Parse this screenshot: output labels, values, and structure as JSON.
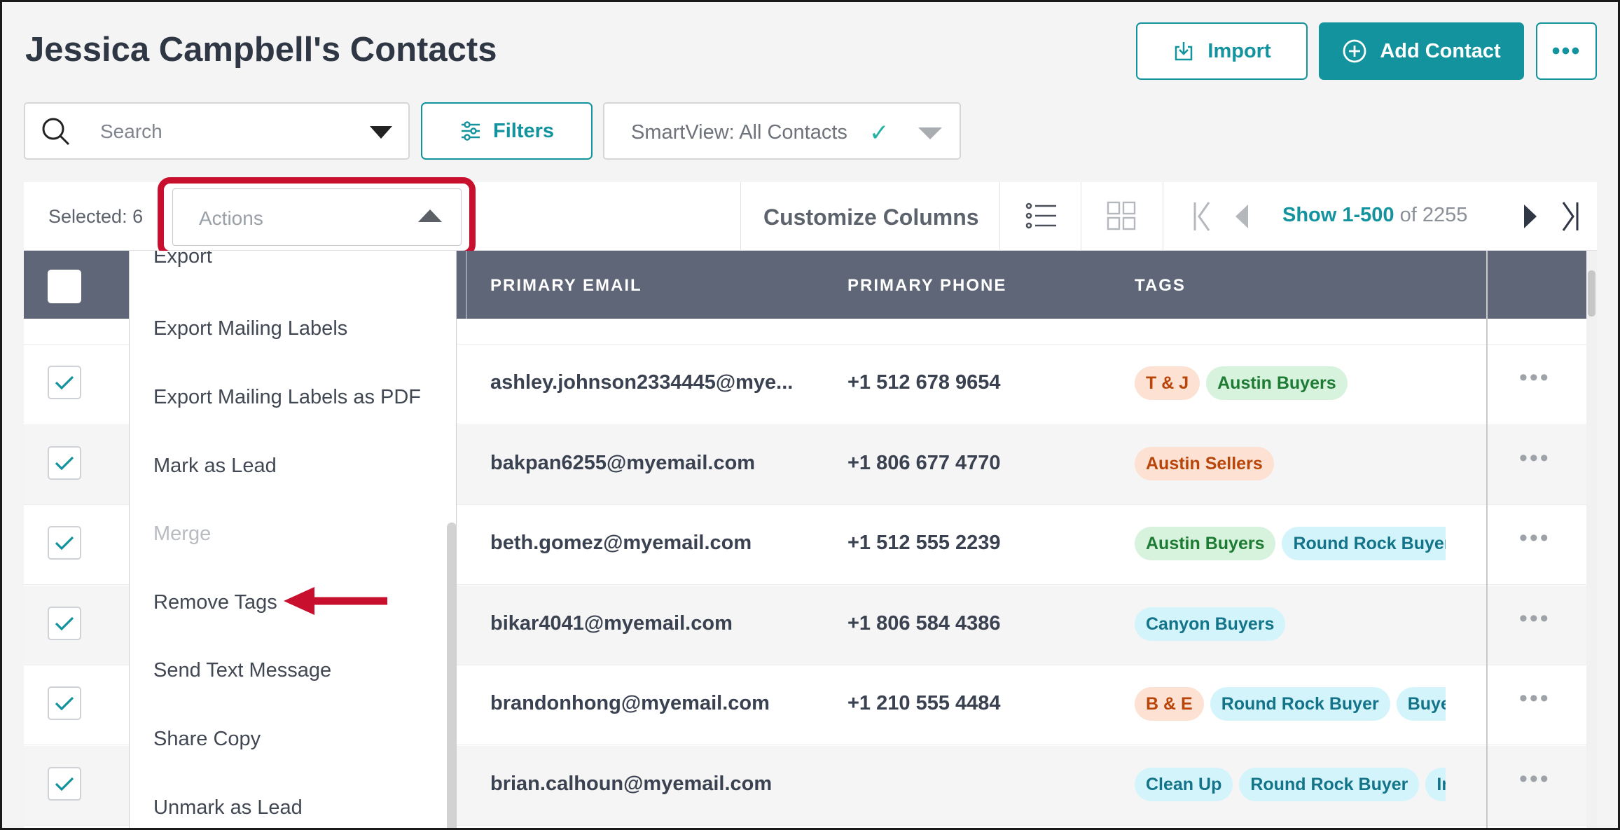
{
  "header": {
    "title": "Jessica Campbell's Contacts",
    "import_label": "Import",
    "add_contact_label": "Add Contact",
    "more_label": "•••"
  },
  "toolbar": {
    "search_placeholder": "Search",
    "filters_label": "Filters",
    "smartview_label": "SmartView: All Contacts"
  },
  "selection_bar": {
    "selected_text": "Selected: 6",
    "actions_label": "Actions",
    "customize_columns_label": "Customize Columns",
    "pager_range": "Show 1-500",
    "pager_total": "of 2255"
  },
  "table": {
    "columns": [
      "PRIMARY EMAIL",
      "PRIMARY PHONE",
      "TAGS"
    ],
    "rows": [
      {
        "email": "ashley.johnson2334445@mye...",
        "phone": "+1 512 678 9654",
        "tags": [
          {
            "label": "T & J",
            "color": "orange"
          },
          {
            "label": "Austin Buyers",
            "color": "green"
          }
        ]
      },
      {
        "email": "bakpan6255@myemail.com",
        "phone": "+1 806 677 4770",
        "tags": [
          {
            "label": "Austin Sellers",
            "color": "orange"
          }
        ]
      },
      {
        "email": "beth.gomez@myemail.com",
        "phone": "+1 512 555 2239",
        "tags": [
          {
            "label": "Austin Buyers",
            "color": "green"
          },
          {
            "label": "Round Rock Buyer",
            "color": "blue"
          }
        ]
      },
      {
        "email": "bikar4041@myemail.com",
        "phone": "+1 806 584 4386",
        "tags": [
          {
            "label": "Canyon Buyers",
            "color": "blue"
          }
        ]
      },
      {
        "email": "brandonhong@myemail.com",
        "phone": "+1 210 555 4484",
        "tags": [
          {
            "label": "B & E",
            "color": "orange"
          },
          {
            "label": "Round Rock Buyer",
            "color": "blue"
          },
          {
            "label": "Buyer",
            "color": "blue"
          }
        ]
      },
      {
        "email": "brian.calhoun@myemail.com",
        "phone": "",
        "tags": [
          {
            "label": "Clean Up",
            "color": "blue"
          },
          {
            "label": "Round Rock Buyer",
            "color": "blue"
          },
          {
            "label": "Inv",
            "color": "blue"
          }
        ]
      }
    ]
  },
  "actions_menu": {
    "items": [
      {
        "label": "Export",
        "enabled": true
      },
      {
        "label": "Export Mailing Labels",
        "enabled": true
      },
      {
        "label": "Export Mailing Labels as PDF",
        "enabled": true
      },
      {
        "label": "Mark as Lead",
        "enabled": true
      },
      {
        "label": "Merge",
        "enabled": false
      },
      {
        "label": "Remove Tags",
        "enabled": true
      },
      {
        "label": "Send Text Message",
        "enabled": true
      },
      {
        "label": "Share Copy",
        "enabled": true
      },
      {
        "label": "Unmark as Lead",
        "enabled": true
      }
    ]
  },
  "colors": {
    "accent": "#12939d",
    "header_bg": "#5e6678",
    "highlight": "#c8102e"
  }
}
